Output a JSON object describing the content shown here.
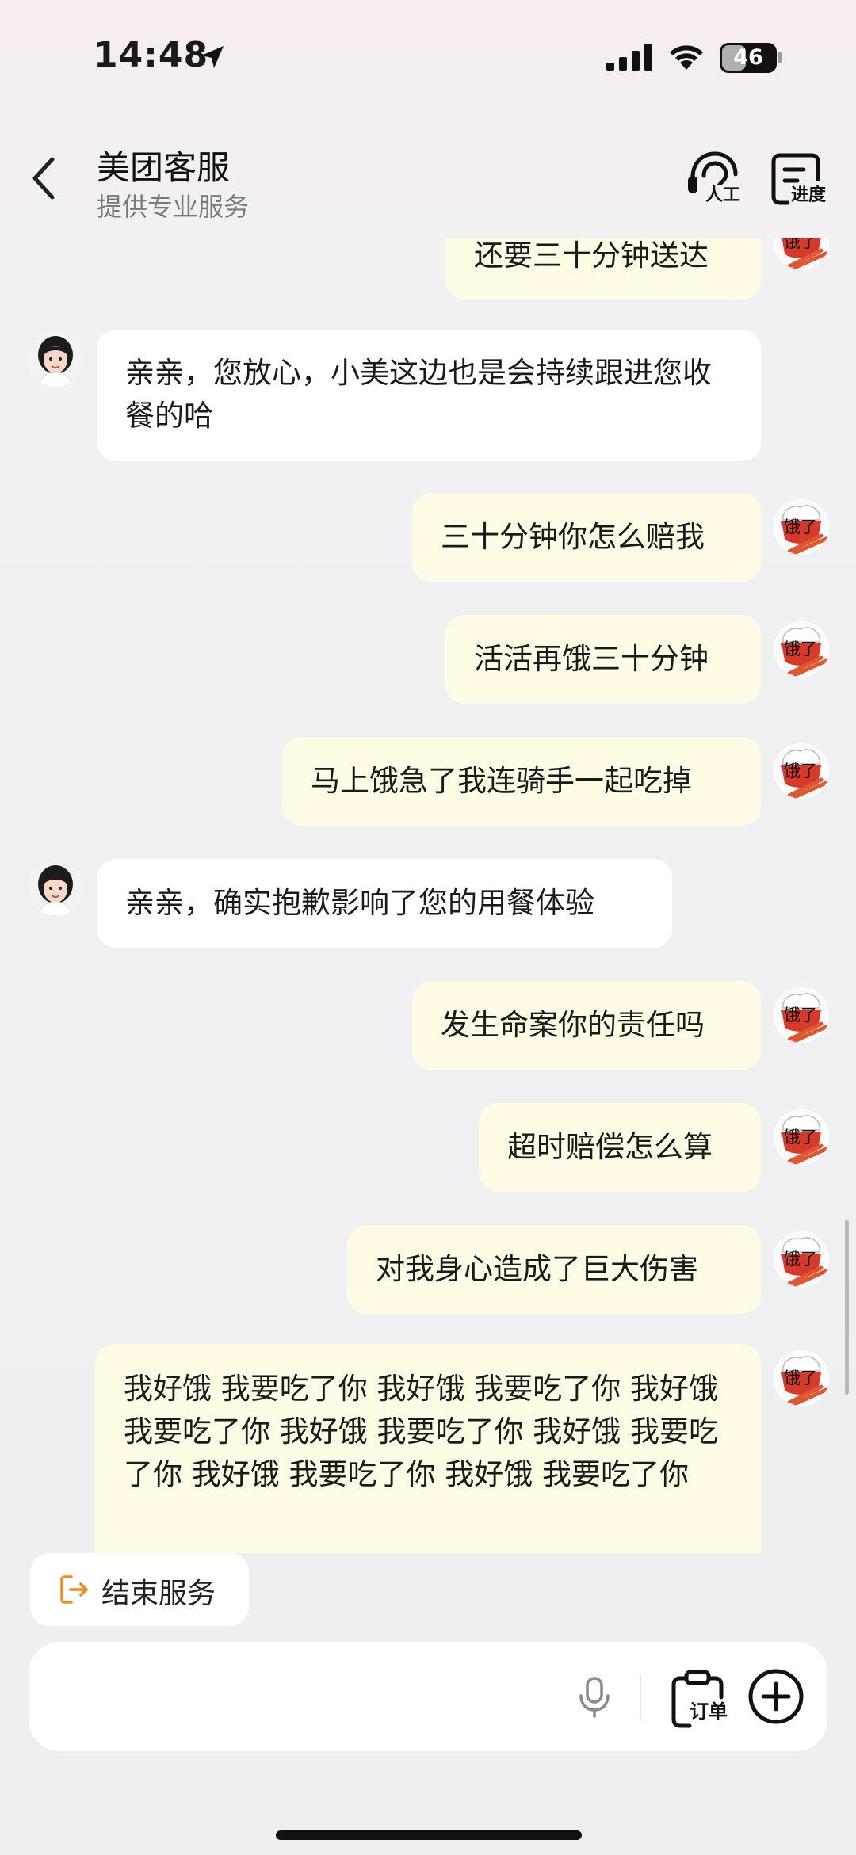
{
  "status_bar": {
    "time": "14:48",
    "battery_level": "46",
    "battery_fraction": 0.46
  },
  "header": {
    "title": "美团客服",
    "subtitle": "提供专业服务",
    "manual_label": "人工",
    "progress_label": "进度"
  },
  "messages": [
    {
      "role": "user",
      "text": "还要三十分钟送达"
    },
    {
      "role": "agent",
      "text": "亲亲，您放心，小美这边也是会持续跟进您收餐的哈"
    },
    {
      "role": "user",
      "text": "三十分钟你怎么赔我"
    },
    {
      "role": "user",
      "text": "活活再饿三十分钟"
    },
    {
      "role": "user",
      "text": "马上饿急了我连骑手一起吃掉"
    },
    {
      "role": "agent",
      "text": "亲亲，确实抱歉影响了您的用餐体验"
    },
    {
      "role": "user",
      "text": "发生命案你的责任吗"
    },
    {
      "role": "user",
      "text": "超时赔偿怎么算"
    },
    {
      "role": "user",
      "text": "对我身心造成了巨大伤害"
    },
    {
      "role": "user",
      "text": "我好饿 我要吃了你 我好饿 我要吃了你 我好饿 我要吃了你 我好饿 我要吃了你 我好饿 我要吃了你 我好饿 我要吃了你 我好饿 我要吃了你"
    }
  ],
  "user_avatar_text": "饿了",
  "end_service": {
    "label": "结束服务"
  },
  "input": {
    "placeholder": "",
    "value": "",
    "order_label": "订单"
  },
  "colors": {
    "user_bubble": "#fffbe4",
    "agent_bubble": "#ffffff",
    "accent": "#f08a24"
  }
}
